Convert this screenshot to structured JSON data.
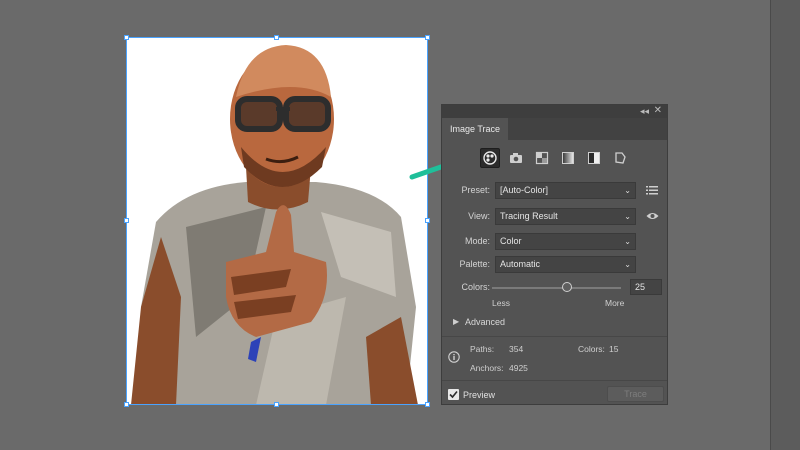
{
  "panel": {
    "title": "Image Trace",
    "collapse_glyph": "◂◂",
    "close_glyph": "✕",
    "preset": {
      "label": "Preset:",
      "value": "[Auto-Color]"
    },
    "view": {
      "label": "View:",
      "value": "Tracing Result"
    },
    "mode": {
      "label": "Mode:",
      "value": "Color"
    },
    "palette": {
      "label": "Palette:",
      "value": "Automatic"
    },
    "colors_slider": {
      "label": "Colors:",
      "value": "25",
      "min_label": "Less",
      "max_label": "More",
      "fraction": 0.58
    },
    "advanced": {
      "label": "Advanced"
    },
    "stats": {
      "paths_label": "Paths:",
      "paths_value": "354",
      "colors_label": "Colors:",
      "colors_value": "15",
      "anchors_label": "Anchors:",
      "anchors_value": "4925"
    },
    "preview": {
      "label": "Preview",
      "checked": true
    },
    "trace_button": "Trace",
    "preset_icons": [
      "auto-color-icon",
      "high-fidelity-photo-icon",
      "low-fidelity-photo-icon",
      "grayscale-icon",
      "black-and-white-icon",
      "outline-icon"
    ]
  },
  "colors": {
    "arrow": "#1fbf9a",
    "selection": "#4aa3ff",
    "panel_bg": "#535353"
  }
}
